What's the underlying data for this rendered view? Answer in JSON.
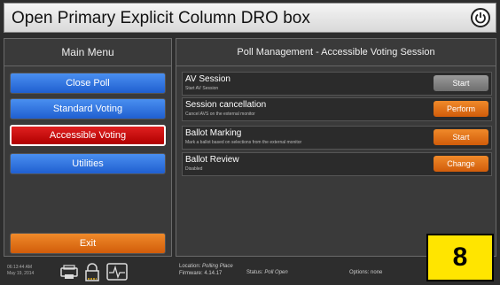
{
  "title": "Open Primary Explicit Column DRO box",
  "left_panel": {
    "heading": "Main Menu",
    "buttons": [
      {
        "label": "Close Poll"
      },
      {
        "label": "Standard Voting"
      },
      {
        "label": "Accessible Voting"
      },
      {
        "label": "Utilities"
      }
    ],
    "exit_label": "Exit"
  },
  "right_panel": {
    "heading": "Poll Management - Accessible Voting Session",
    "rows": [
      {
        "title": "AV Session",
        "subtitle": "Start AV Session",
        "action": "Start",
        "action_color": "#8a8a8a"
      },
      {
        "title": "Session cancellation",
        "subtitle": "Cancel AVS on the external monitor",
        "action": "Perform",
        "action_color": "#e3701a"
      },
      {
        "title": "Ballot Marking",
        "subtitle": "Mark a ballot based on selections from the external monitor",
        "action": "Start",
        "action_color": "#e3701a"
      },
      {
        "title": "Ballot Review",
        "subtitle": "Disabled",
        "action": "Change",
        "action_color": "#e3701a"
      }
    ]
  },
  "footer": {
    "time": "06:13:44 AM",
    "date": "May 19, 2014",
    "location_label": "Location:",
    "location_value": "Polling Place",
    "firmware_label": "Firmware:",
    "firmware_value": "4.14.17",
    "status_label": "Status:",
    "status_value": "Poll Open",
    "options_label": "Options:",
    "options_value": "none",
    "icons": [
      "printer-icon",
      "lock-icon",
      "heartbeat-icon"
    ]
  },
  "badge": "8"
}
